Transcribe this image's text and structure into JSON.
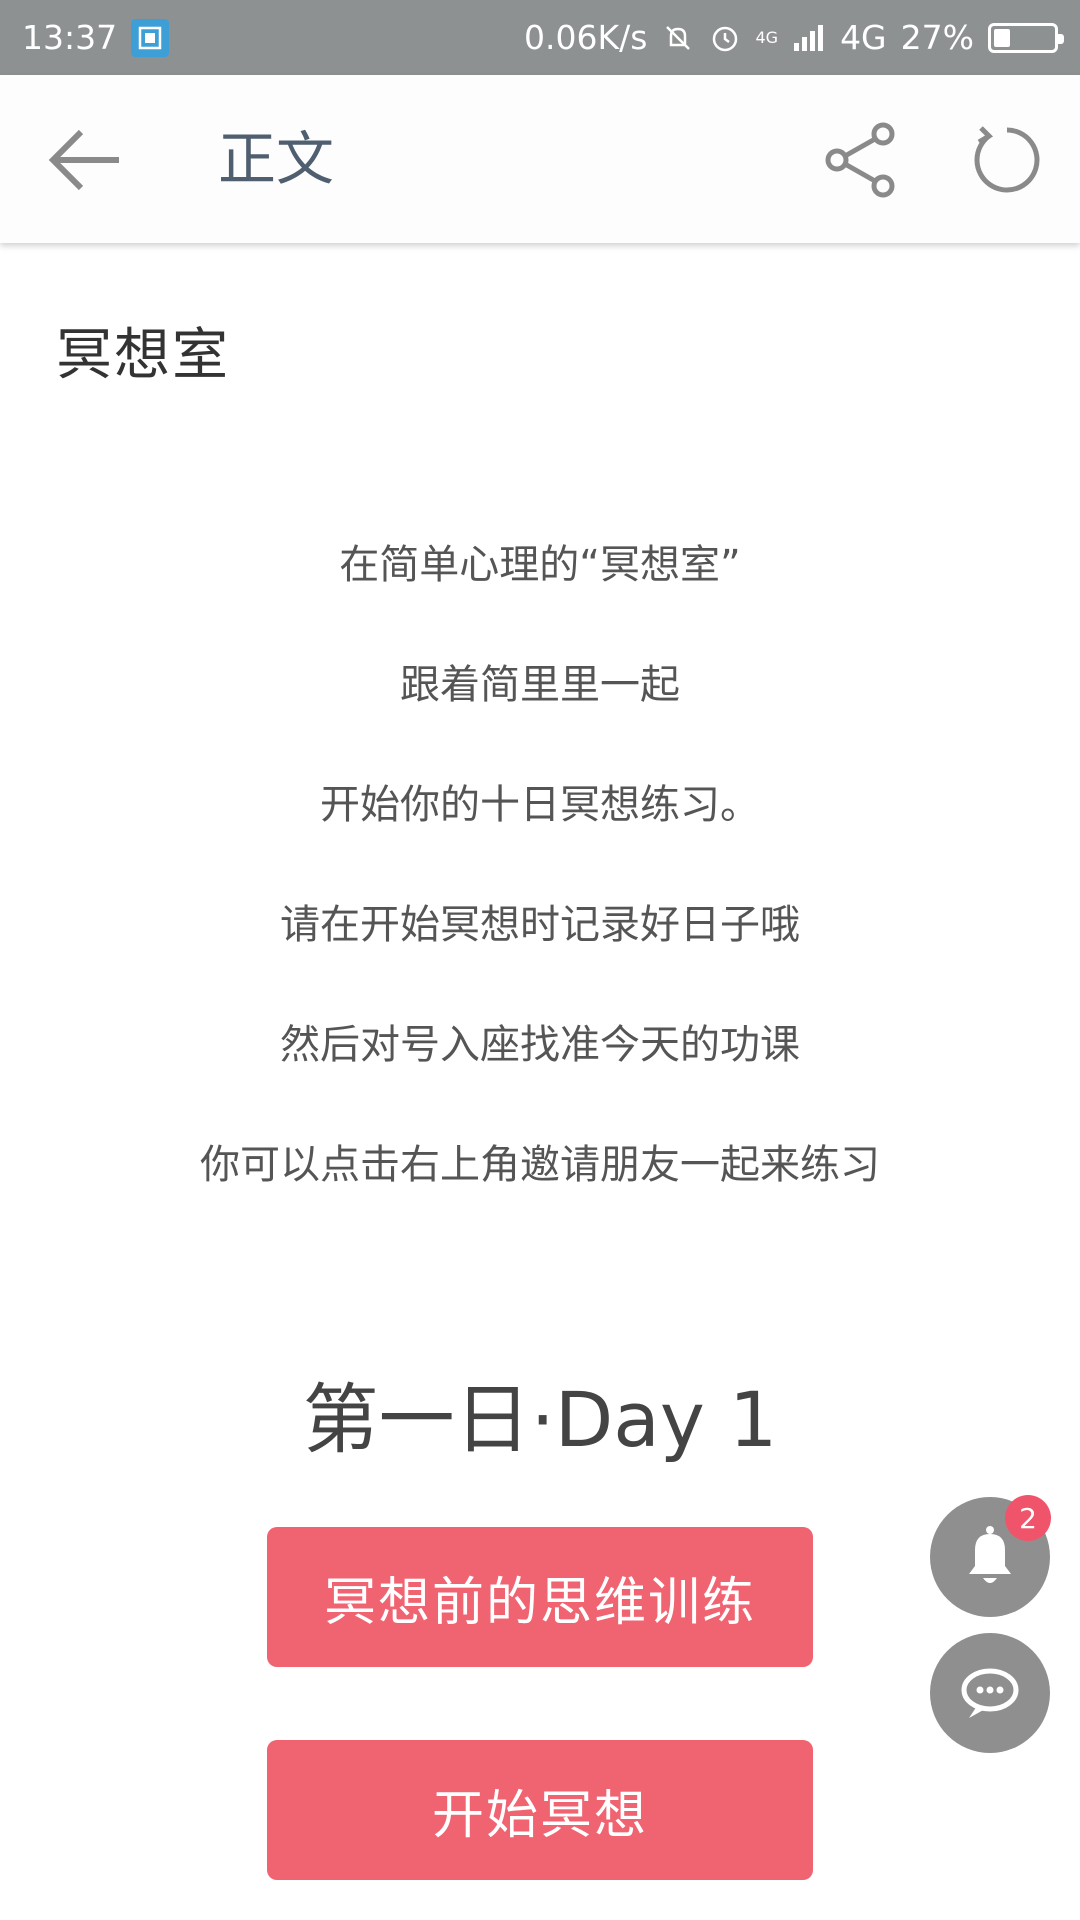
{
  "status_bar": {
    "time": "13:37",
    "net_speed": "0.06K/s",
    "network_small": "4G",
    "network": "4G",
    "battery": "27%",
    "battery_level": 0.27
  },
  "app_bar": {
    "title": "正文"
  },
  "article": {
    "heading": "冥想室",
    "paragraphs": [
      "在简单心理的“冥想室”",
      "跟着简里里一起",
      "开始你的十日冥想练习。",
      "请在开始冥想时记录好日子哦",
      "然后对号入座找准今天的功课",
      "你可以点击右上角邀请朋友一起来练习"
    ],
    "day_title": "第一日·Day 1",
    "buttons": {
      "thinking_training": "冥想前的思维训练",
      "start_meditation": "开始冥想"
    }
  },
  "floating": {
    "notification_count": "2"
  },
  "colors": {
    "accent": "#f06371",
    "status_bar": "#8e9192",
    "fab": "#8f8f8f",
    "badge": "#f0546b"
  }
}
